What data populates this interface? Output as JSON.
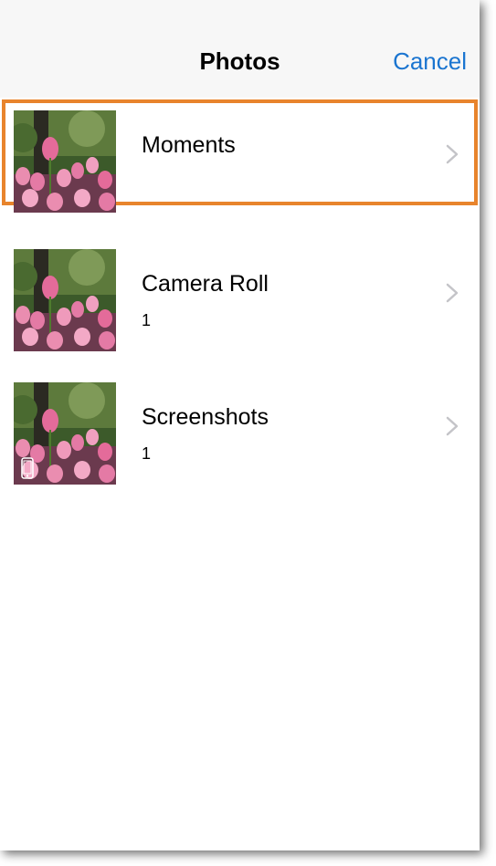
{
  "navbar": {
    "title": "Photos",
    "cancel_label": "Cancel",
    "accent_color": "#1b75d0"
  },
  "highlight_color": "#e8842c",
  "albums": [
    {
      "title": "Moments",
      "count": "",
      "thumbnail_icon": "pink-tulips-photo",
      "badge_icon": ""
    },
    {
      "title": "Camera Roll",
      "count": "1",
      "thumbnail_icon": "pink-tulips-photo",
      "badge_icon": ""
    },
    {
      "title": "Screenshots",
      "count": "1",
      "thumbnail_icon": "pink-tulips-photo",
      "badge_icon": "phone-icon"
    }
  ]
}
